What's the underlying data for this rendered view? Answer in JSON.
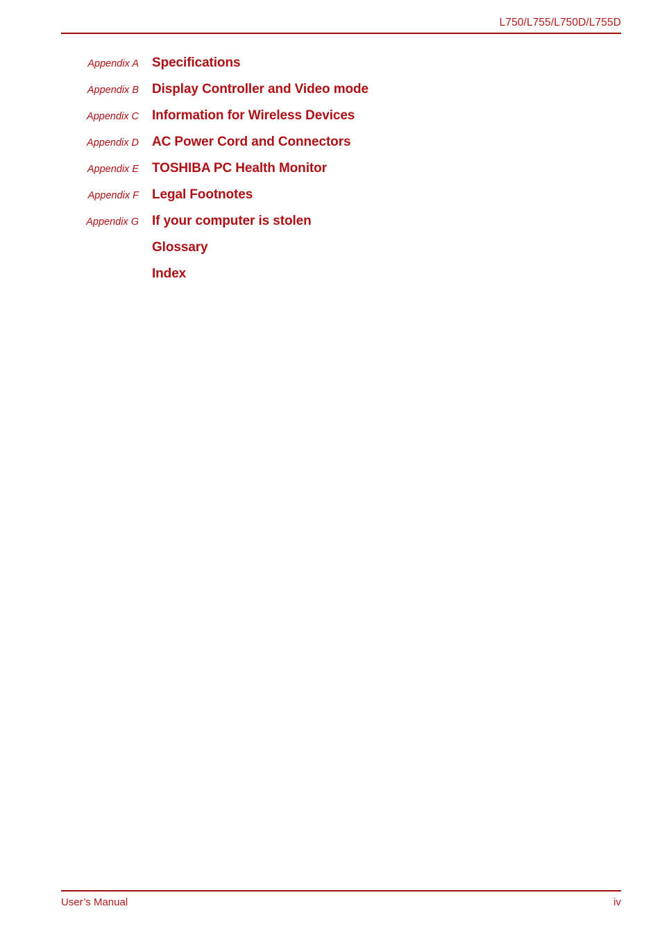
{
  "colors": {
    "heading_red": "#ae1015",
    "rule_red": "#a00d0d",
    "running_red": "#b51a1a",
    "page_background": "#ffffff"
  },
  "header": {
    "model_line": "L750/L755/L750D/L755D"
  },
  "contents": {
    "rows": [
      {
        "label": "Appendix A",
        "title": "Specifications"
      },
      {
        "label": "Appendix B",
        "title": "Display Controller and Video mode"
      },
      {
        "label": "Appendix C",
        "title": "Information for Wireless Devices"
      },
      {
        "label": "Appendix D",
        "title": "AC Power Cord and Connectors"
      },
      {
        "label": "Appendix E",
        "title": "TOSHIBA PC Health Monitor"
      },
      {
        "label": "Appendix F",
        "title": "Legal Footnotes"
      },
      {
        "label": "Appendix G",
        "title": "If your computer is stolen"
      },
      {
        "label": "",
        "title": "Glossary"
      },
      {
        "label": "",
        "title": "Index"
      }
    ]
  },
  "footer": {
    "manual_label": "User’s Manual",
    "page_number": "iv"
  }
}
